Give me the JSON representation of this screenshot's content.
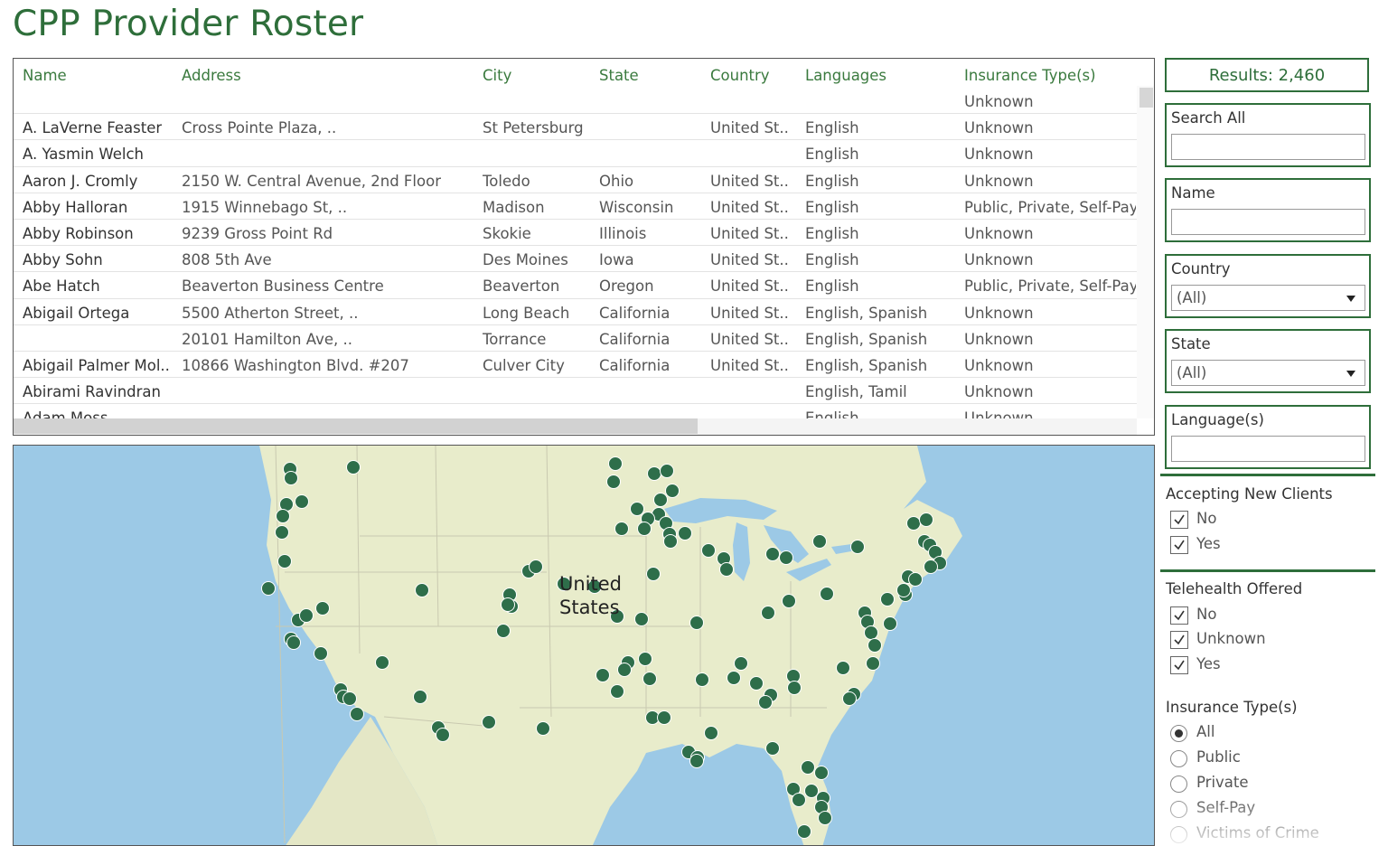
{
  "title": "CPP Provider Roster",
  "table": {
    "columns": [
      "Name",
      "Address",
      "City",
      "State",
      "Country",
      "Languages",
      "Insurance Type(s)"
    ],
    "rows": [
      {
        "name": "",
        "address": "",
        "city": "",
        "state": "",
        "country": "",
        "languages": "",
        "insurance": "Unknown"
      },
      {
        "name": "A. LaVerne Feaster",
        "address": "Cross Pointe Plaza, ..",
        "city": "St Petersburg",
        "state": "",
        "country": "United St..",
        "languages": "English",
        "insurance": "Unknown"
      },
      {
        "name": "A. Yasmin Welch",
        "address": "",
        "city": "",
        "state": "",
        "country": "",
        "languages": "English",
        "insurance": "Unknown"
      },
      {
        "name": "Aaron J. Cromly",
        "address": "2150 W. Central Avenue, 2nd Floor",
        "city": "Toledo",
        "state": "Ohio",
        "country": "United St..",
        "languages": "English",
        "insurance": "Unknown"
      },
      {
        "name": "Abby  Halloran",
        "address": "1915 Winnebago St, ..",
        "city": "Madison",
        "state": "Wisconsin",
        "country": "United St..",
        "languages": "English",
        "insurance": "Public, Private, Self-Pay"
      },
      {
        "name": "Abby Robinson",
        "address": "9239 Gross Point Rd",
        "city": "Skokie",
        "state": "Illinois",
        "country": "United St..",
        "languages": "English",
        "insurance": "Unknown"
      },
      {
        "name": "Abby Sohn",
        "address": "808 5th Ave",
        "city": "Des Moines",
        "state": "Iowa",
        "country": "United St..",
        "languages": "English",
        "insurance": "Unknown"
      },
      {
        "name": "Abe Hatch",
        "address": "Beaverton Business Centre",
        "city": "Beaverton",
        "state": "Oregon",
        "country": "United St..",
        "languages": "English",
        "insurance": "Public, Private, Self-Pay"
      },
      {
        "name": "Abigail Ortega",
        "address": "5500 Atherton Street, ..",
        "city": "Long Beach",
        "state": "California",
        "country": "United St..",
        "languages": "English, Spanish",
        "insurance": "Unknown"
      },
      {
        "name": "",
        "address": "20101 Hamilton Ave, ..",
        "city": "Torrance",
        "state": "California",
        "country": "United St..",
        "languages": "English, Spanish",
        "insurance": "Unknown"
      },
      {
        "name": "Abigail Palmer Mol..",
        "address": "10866 Washington Blvd. #207",
        "city": "Culver City",
        "state": "California",
        "country": "United St..",
        "languages": "English, Spanish",
        "insurance": "Unknown"
      },
      {
        "name": "Abirami Ravindran",
        "address": "",
        "city": "",
        "state": "",
        "country": "",
        "languages": "English, Tamil",
        "insurance": "Unknown"
      },
      {
        "name": "Adam  Moss",
        "address": "",
        "city": "",
        "state": "",
        "country": "",
        "languages": "English",
        "insurance": "Unknown"
      }
    ]
  },
  "map": {
    "label_line1": "United",
    "label_line2": "States",
    "water_color": "#9cc9e6",
    "land_color": "#e8eccb",
    "marker_color": "#2e6e4a"
  },
  "filters": {
    "results": "Results: 2,460",
    "search_all_label": "Search All",
    "name_label": "Name",
    "country_label": "Country",
    "country_value": "(All)",
    "state_label": "State",
    "state_value": "(All)",
    "language_label": "Language(s)",
    "accepting": {
      "title": "Accepting New Clients",
      "options": [
        "No",
        "Yes"
      ]
    },
    "telehealth": {
      "title": "Telehealth Offered",
      "options": [
        "No",
        "Unknown",
        "Yes"
      ]
    },
    "insurance": {
      "title": "Insurance Type(s)",
      "options": [
        "All",
        "Public",
        "Private",
        "Self-Pay",
        "Victims of Crime"
      ],
      "selected": "All"
    }
  },
  "colors": {
    "brand_green": "#2e6e3a"
  }
}
